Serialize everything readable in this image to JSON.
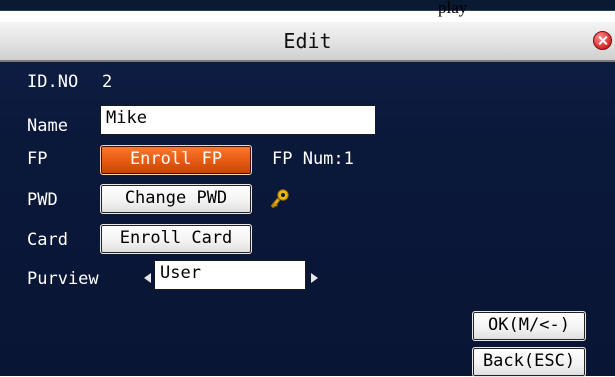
{
  "window": {
    "top_fragment_text": "play",
    "title": "Edit"
  },
  "form": {
    "id_label": "ID.NO",
    "id_value": "2",
    "name_label": "Name",
    "name_value": "Mike",
    "fp_label": "FP",
    "fp_button": "Enroll FP",
    "fp_num": "FP Num:1",
    "pwd_label": "PWD",
    "pwd_button": "Change PWD",
    "card_label": "Card",
    "card_button": "Enroll Card",
    "purview_label": "Purview",
    "purview_value": "User"
  },
  "actions": {
    "ok_label": "OK(M/<-)",
    "back_label": "Back(ESC)"
  },
  "icons": {
    "close": "close-icon",
    "key": "key-icon",
    "prev": "left-arrow-icon",
    "next": "right-arrow-icon"
  },
  "colors": {
    "screen_bg": "#0b1a3a",
    "selected_button": "#e45a12",
    "titlebar": "#e6e6e6"
  }
}
